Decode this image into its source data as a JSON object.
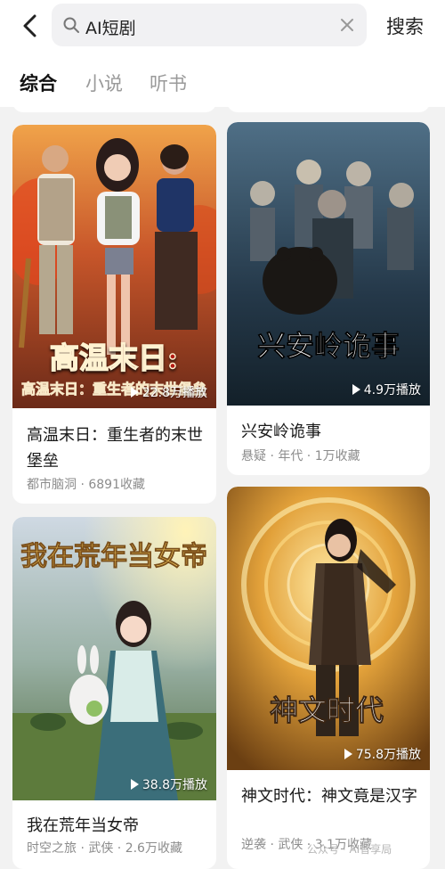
{
  "header": {
    "search_query": "AI短剧",
    "search_button": "搜索"
  },
  "tabs": [
    {
      "label": "综合",
      "active": true
    },
    {
      "label": "小说",
      "active": false
    },
    {
      "label": "听书",
      "active": false
    }
  ],
  "cards": [
    {
      "title": "高温末日：重生者的末世堡垒",
      "meta": "都市脑洞 · 6891收藏",
      "play_count": "22.8万播放",
      "cover_caption": "高温末日:"
    },
    {
      "title": "兴安岭诡事",
      "meta": "悬疑 · 年代 · 1万收藏",
      "play_count": "4.9万播放",
      "cover_caption": "兴安岭诡事"
    },
    {
      "title": "我在荒年当女帝",
      "meta": "时空之旅 · 武侠 · 2.6万收藏",
      "play_count": "38.8万播放",
      "cover_caption": "我在荒年当女帝"
    },
    {
      "title": "神文时代：神文竟是汉字",
      "meta": "逆袭 · 武侠 · 3.1万收藏",
      "play_count": "75.8万播放",
      "cover_caption": "神文时代"
    }
  ],
  "watermark": "公众号 · AI智享局",
  "colors": {
    "background": "#f2f2f2",
    "card": "#ffffff",
    "meta_text": "#8c8c8c",
    "tab_inactive": "#9a9a9a"
  }
}
